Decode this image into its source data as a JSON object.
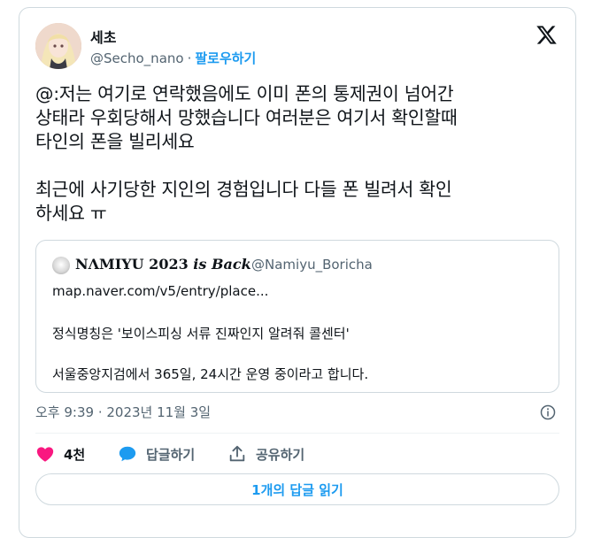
{
  "author": {
    "name": "세초",
    "handle": "@Secho_nano",
    "separator": "·",
    "follow_label": "팔로우하기"
  },
  "tweet": {
    "text": "@:저는 여기로 연락했음에도 이미 폰의 통제권이 넘어간\n상태라 우회당해서 망했습니다 여러분은 여기서 확인할때\n타인의 폰을 빌리세요\n\n최근에 사기당한 지인의 경험입니다 다들 폰 빌려서 확인\n하세요 ㅠ"
  },
  "quote": {
    "name_prefix": "NΛMIYU 2023 ",
    "name_italic": "is Back",
    "handle": "@Namiyu_Boricha",
    "link": "map.naver.com/v5/entry/place...",
    "line1": "정식명칭은 '보이스피싱 서류 진짜인지 알려줘 콜센터'",
    "line2": "서울중앙지검에서 365일, 24시간 운영 중이라고 합니다."
  },
  "meta": {
    "timestamp": "오후 9:39 · 2023년 11월 3일"
  },
  "actions": {
    "like_count": "4천",
    "reply_label": "답글하기",
    "share_label": "공유하기"
  },
  "read_replies_label": "1개의 답글 읽기",
  "colors": {
    "accent": "#1d9bf0",
    "like": "#f91880",
    "muted": "#536471",
    "border": "#cfd9de"
  }
}
